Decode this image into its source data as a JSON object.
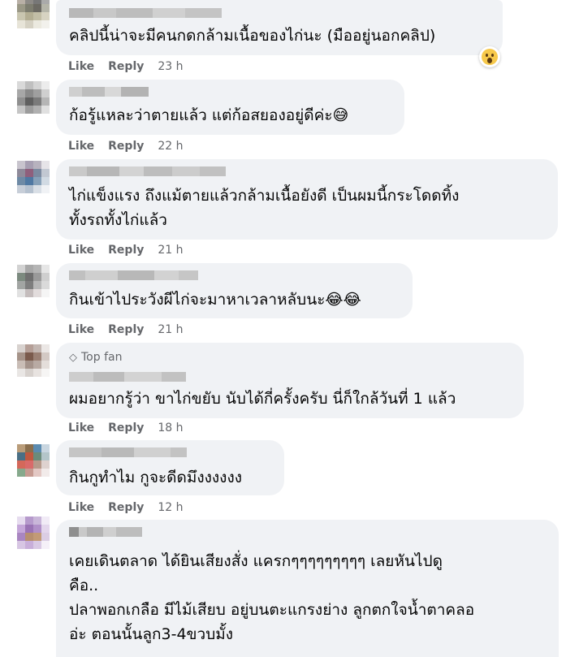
{
  "comments": [
    {
      "text": "คลิปนี้น่าจะมีคนกดกล้ามเนื้อของไก่นะ (มืออยู่นอกคลิป)",
      "like": "Like",
      "reply": "Reply",
      "time": "23 h",
      "reaction": "wow-icon"
    },
    {
      "text": "ก้อรู้แหละว่าตายแล้ว แต่ก้อสยองอยู่ดีค่ะ😅",
      "like": "Like",
      "reply": "Reply",
      "time": "22 h"
    },
    {
      "text": "ไก่แข็งแรง ถึงแม้ตายแล้วกล้ามเนื้อยังดี เป็นผมนี้กระโดดทิ้ง\nทั้งรถทั้งไก่แล้ว",
      "like": "Like",
      "reply": "Reply",
      "time": "21 h"
    },
    {
      "text": "กินเข้าไประวังผีไก่จะมาหาเวลาหลับนะ😂😂",
      "like": "Like",
      "reply": "Reply",
      "time": "21 h"
    },
    {
      "badge": "Top fan",
      "text": "ผมอยากรู้ว่า ขาไก่ขยับ นับได้กี่ครั้งครับ นี่ก็ใกล้วันที่ 1 แล้ว",
      "like": "Like",
      "reply": "Reply",
      "time": "18 h"
    },
    {
      "text": "กินกูทำไม กูจะดีดมึงงงงงง",
      "like": "Like",
      "reply": "Reply",
      "time": "12 h"
    },
    {
      "text": "เคยเดินตลาด ได้ยินเสียงสั่ง แครกๆๆๆๆๆๆๆๆๆ เลยหันไปดู\nคือ..\nปลาพอกเกลือ มีไม้เสียบ อยู่บนตะแกรงย่าง ลูกตกใจน้ำตาคลอ\nอ่ะ ตอนนั้นลูก3-4ขวบมั้ง"
    }
  ],
  "colors": {
    "bubble": "#f0f2f5",
    "meta": "#65676b",
    "text": "#050505"
  }
}
